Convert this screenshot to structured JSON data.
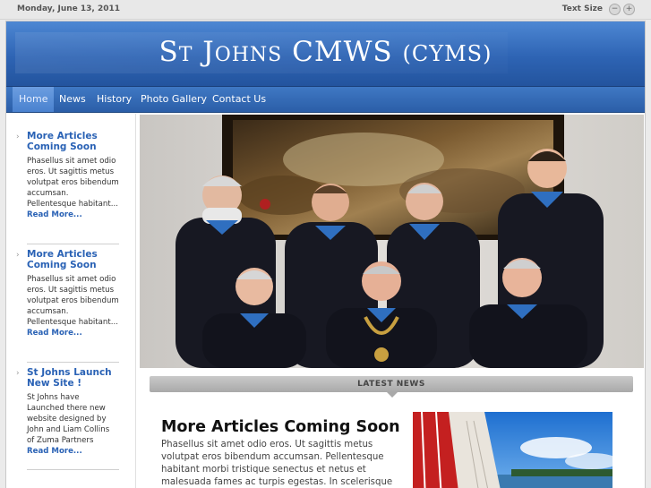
{
  "topbar": {
    "date": "Monday, June 13, 2011",
    "text_size_label": "Text Size",
    "decrease_icon": "minus-icon",
    "increase_icon": "plus-icon"
  },
  "header": {
    "title": "St Johns CMWS",
    "subtitle": "(CYMS)"
  },
  "nav": {
    "items": [
      {
        "label": "Home",
        "active": true
      },
      {
        "label": "News"
      },
      {
        "label": "History"
      },
      {
        "label": "Photo Gallery"
      },
      {
        "label": "Contact Us"
      }
    ]
  },
  "sidebar": {
    "articles": [
      {
        "title": "More Articles Coming Soon",
        "text": "Phasellus sit amet odio eros. Ut sagittis metus volutpat eros bibendum accumsan. Pellentesque habitant...",
        "more": "Read More..."
      },
      {
        "title": "More Articles Coming Soon",
        "text": "Phasellus sit amet odio eros. Ut sagittis metus volutpat eros bibendum accumsan. Pellentesque habitant...",
        "more": "Read More..."
      },
      {
        "title": "St Johns Launch New Site !",
        "text": "St Johns have Launched there new website designed by John and Liam Collins of Zuma Partners",
        "more": "Read More..."
      }
    ]
  },
  "main": {
    "latest_news_label": "LATEST NEWS",
    "article": {
      "title": "More Articles Coming Soon",
      "body": "Phasellus sit amet odio eros. Ut sagittis metus volutpat eros bibendum accumsan. Pellentesque habitant morbi tristique senectus et netus et malesuada fames ac turpis egestas. In scelerisque aliquam tincidunt. Duis quis dui ac"
    }
  },
  "colors": {
    "brand_blue": "#2e64b4",
    "link_blue": "#2a62b5"
  }
}
